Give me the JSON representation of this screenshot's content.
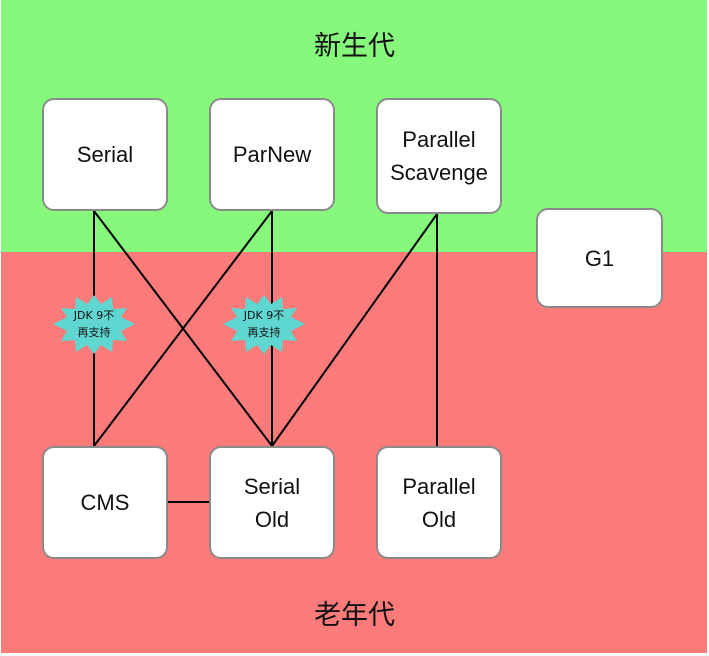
{
  "zones": {
    "young": {
      "title": "新生代",
      "color": "#86f97c"
    },
    "old": {
      "title": "老年代",
      "color": "#fb7b7b"
    }
  },
  "collectors": {
    "serial": "Serial",
    "parnew": "ParNew",
    "parallel_scavenge": "Parallel\nScavenge",
    "g1": "G1",
    "cms": "CMS",
    "serial_old": "Serial\nOld",
    "parallel_old": "Parallel\nOld"
  },
  "deprecation_notes": {
    "serial_cms": "JDK 9不\n再支持",
    "parnew_serial_old": "JDK 9不\n再支持"
  },
  "burst_color": "#5fd6d0"
}
